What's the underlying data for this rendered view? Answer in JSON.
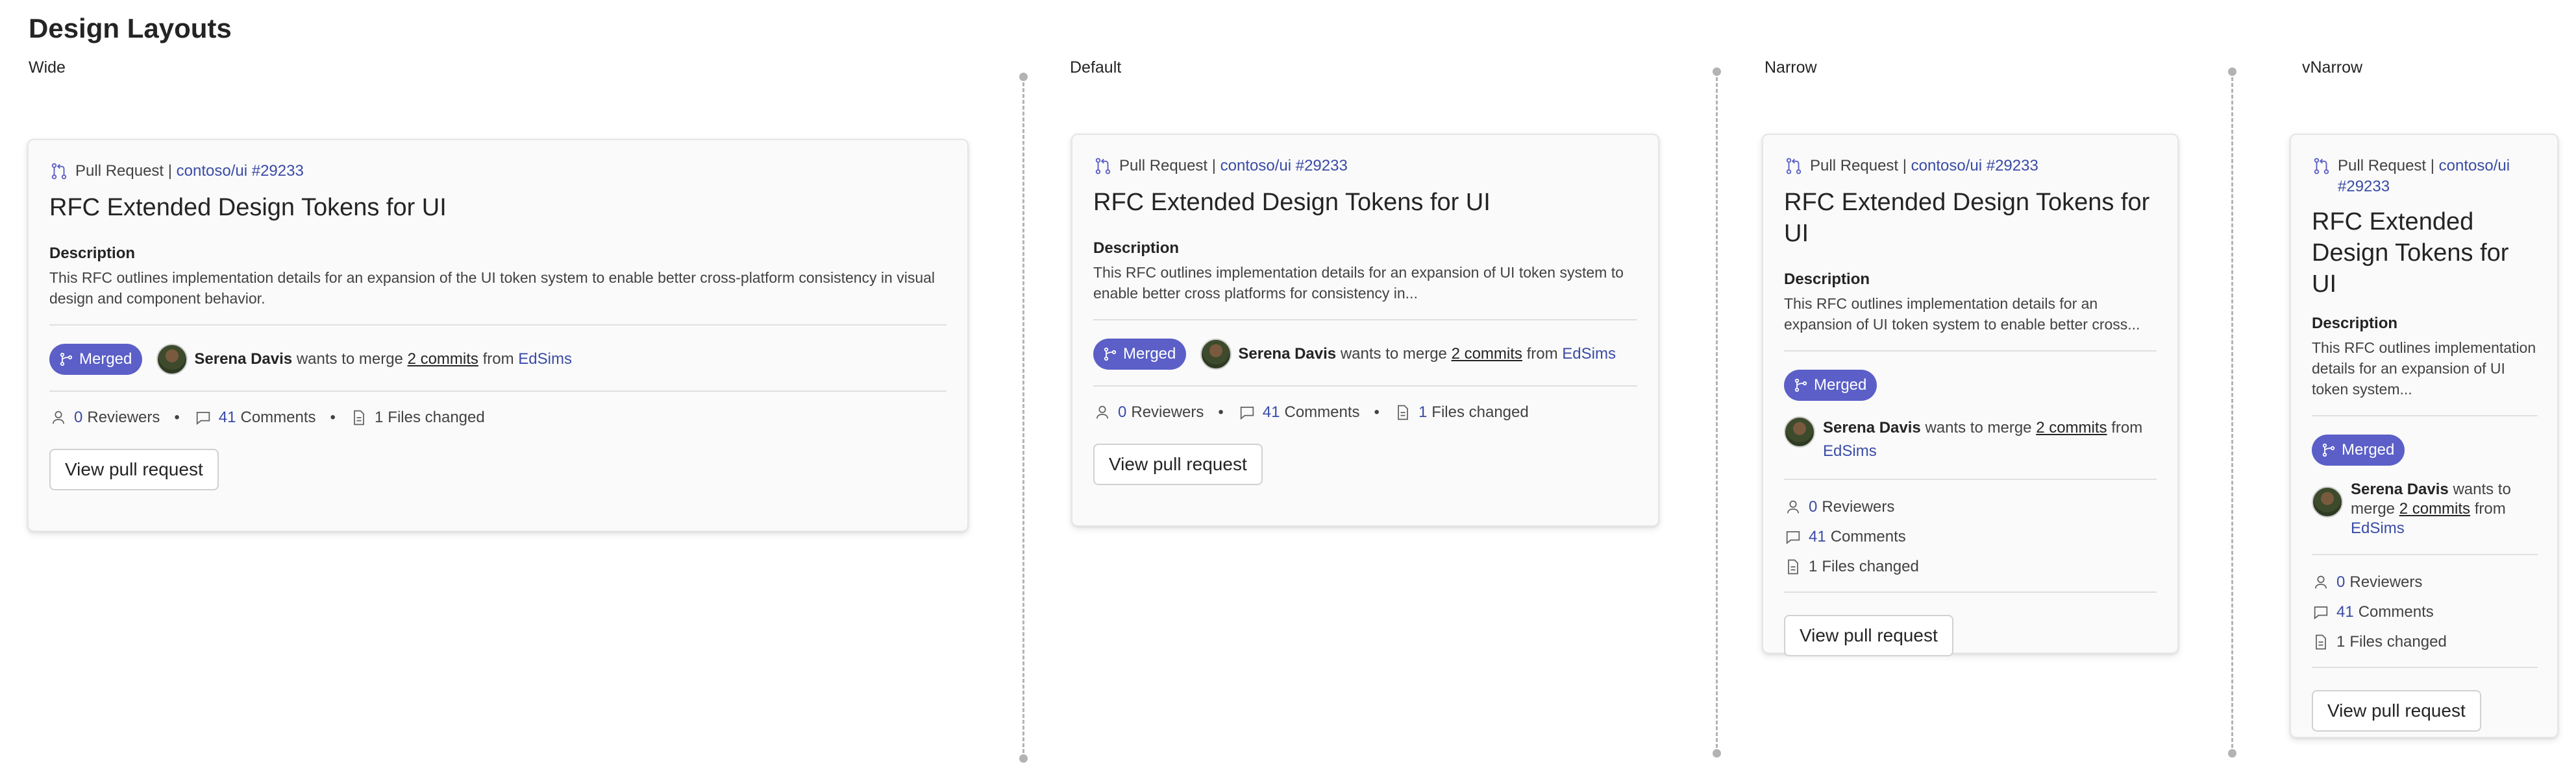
{
  "page": {
    "title": "Design Layouts"
  },
  "columns": [
    {
      "label": "Wide"
    },
    {
      "label": "Default"
    },
    {
      "label": "Narrow"
    },
    {
      "label": "vNarrow"
    }
  ],
  "card": {
    "header_type": "Pull Request |",
    "header_link": "contoso/ui #29233",
    "title": "RFC Extended Design Tokens for UI",
    "description_label": "Description",
    "badge": "Merged",
    "author": "Serena Davis",
    "merge_text": "wants to merge",
    "commits": "2 commits",
    "from_text": "from",
    "branch": "EdSims",
    "reviewers_count": "0",
    "reviewers_label": "Reviewers",
    "comments_count": "41",
    "comments_label": "Comments",
    "files_count": "1",
    "files_label": "Files changed",
    "button": "View pull request",
    "separator": "•"
  },
  "descriptions": {
    "wide": "This RFC outlines implementation details for an expansion of the UI token system to enable better cross-platform consistency in visual design and component behavior.",
    "default": "This RFC outlines implementation details for an expansion of UI token system to enable better cross platforms for consistency in...",
    "narrow": "This RFC outlines implementation details for an expansion of UI token system to enable better cross...",
    "vnarrow": "This RFC outlines implementation details for an expansion of UI token system..."
  },
  "colors": {
    "accent": "#5b5fc7",
    "link": "#3a4ba6"
  }
}
